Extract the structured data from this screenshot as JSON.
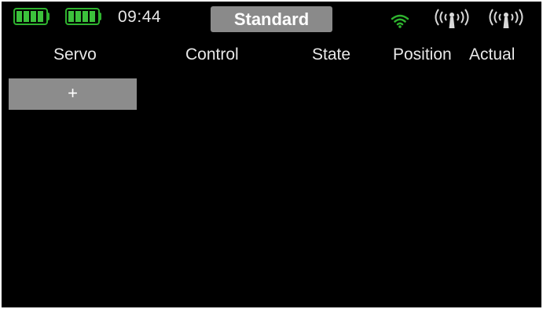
{
  "status_bar": {
    "rx_battery_icon": "battery-icon",
    "tx_battery_icon": "battery-icon",
    "clock": "09:44",
    "model_name": "Standard",
    "signal_icons": [
      "wifi-icon",
      "antenna-icon",
      "antenna-icon"
    ]
  },
  "table": {
    "columns": {
      "servo": "Servo",
      "control": "Control",
      "state": "State",
      "position": "Position",
      "actual": "Actual"
    },
    "rows": []
  },
  "actions": {
    "add_label": "+"
  },
  "colors": {
    "background": "#000000",
    "battery_green": "#3cc23c",
    "wifi_green": "#2fb32f",
    "button_gray": "#8a8a8a",
    "text": "#e8e8e8"
  }
}
